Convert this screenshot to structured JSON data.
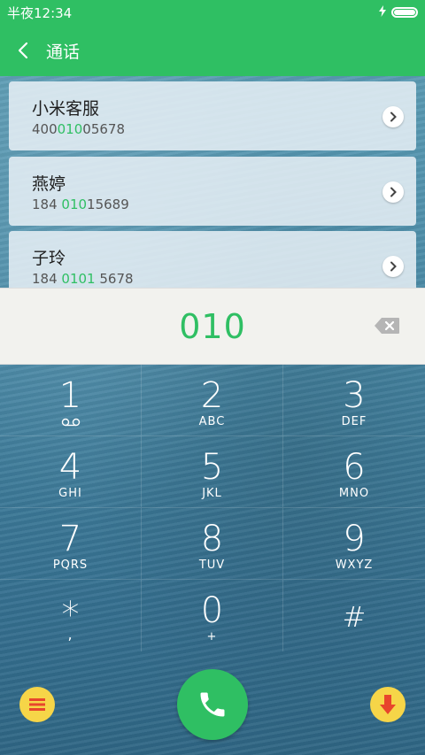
{
  "status_bar": {
    "time": "半夜12:34"
  },
  "header": {
    "title": "通话"
  },
  "contacts": [
    {
      "name": "小米客服",
      "number_pre": "400",
      "number_match": "010",
      "number_post": "05678"
    },
    {
      "name": "燕婷",
      "number_pre": "184 ",
      "number_match": "010",
      "number_post": "15689"
    },
    {
      "name": "子玲",
      "number_pre": "184 ",
      "number_match": "0101",
      "number_post": " 5678"
    }
  ],
  "dial_display": {
    "number": "010"
  },
  "keypad": [
    {
      "digit": "1",
      "sub": ""
    },
    {
      "digit": "2",
      "sub": "ABC"
    },
    {
      "digit": "3",
      "sub": "DEF"
    },
    {
      "digit": "4",
      "sub": "GHI"
    },
    {
      "digit": "5",
      "sub": "JKL"
    },
    {
      "digit": "6",
      "sub": "MNO"
    },
    {
      "digit": "7",
      "sub": "PQRS"
    },
    {
      "digit": "8",
      "sub": "TUV"
    },
    {
      "digit": "9",
      "sub": "WXYZ"
    },
    {
      "digit": "*",
      "sub": ","
    },
    {
      "digit": "0",
      "sub": "+"
    },
    {
      "digit": "#",
      "sub": ""
    }
  ],
  "colors": {
    "accent": "#2fbf63",
    "secondary_button": "#f6d548",
    "down_arrow": "#e8452c"
  }
}
